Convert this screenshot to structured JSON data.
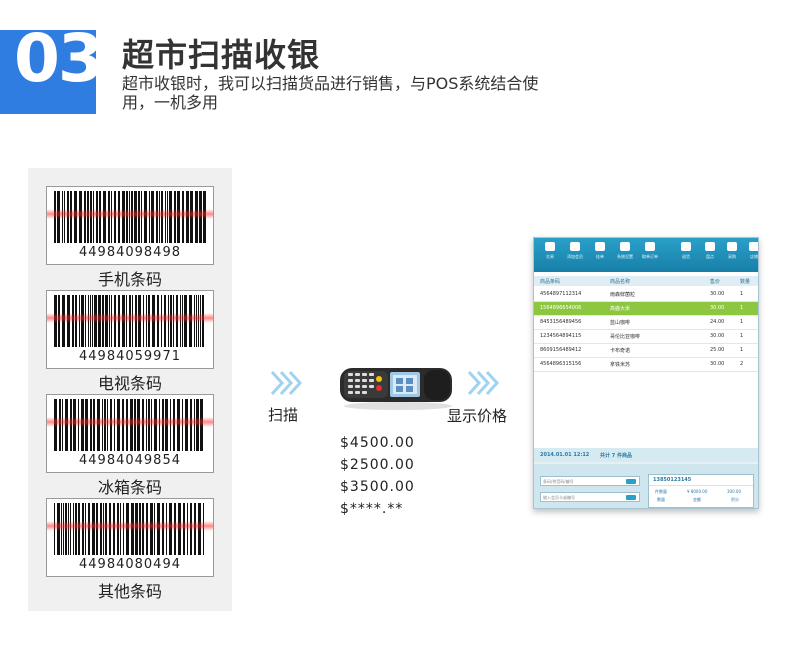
{
  "header": {
    "number": "03",
    "title": "超市扫描收银",
    "subtitle": "超市收银时，我可以扫描货品进行销售，与POS系统结合使用，一机多用"
  },
  "barcodes": [
    {
      "digits": "44984098498",
      "label": "手机条码"
    },
    {
      "digits": "44984059971",
      "label": "电视条码"
    },
    {
      "digits": "44984049854",
      "label": "冰箱条码"
    },
    {
      "digits": "44984080494",
      "label": "其他条码"
    }
  ],
  "flow": {
    "scan_label": "扫描",
    "display_label": "显示价格"
  },
  "prices": [
    "$4500.00",
    "$2500.00",
    "$3500.00",
    "$****.**"
  ],
  "pos": {
    "toolbar": [
      "交易",
      "添加会员",
      "挂单",
      "系统设置",
      "取单订单",
      "退货",
      "盘点",
      "采购",
      "店铺"
    ],
    "columns": [
      "商品条码",
      "商品名称",
      "售价",
      "数量"
    ],
    "rows": [
      {
        "code": "4564897112314",
        "name": "雨森鲜菌粒",
        "price": "30.00",
        "qty": "1",
        "selected": false
      },
      {
        "code": "1564896654006",
        "name": "高盛大米",
        "price": "30.00",
        "qty": "1",
        "selected": true
      },
      {
        "code": "8453156489456",
        "name": "蓝山咖啡",
        "price": "24.00",
        "qty": "1",
        "selected": false
      },
      {
        "code": "1234564894115",
        "name": "哥伦比亚咖啡",
        "price": "30.00",
        "qty": "1",
        "selected": false
      },
      {
        "code": "8609156489412",
        "name": "卡布奇诺",
        "price": "25.00",
        "qty": "1",
        "selected": false
      },
      {
        "code": "4564896315156",
        "name": "拿铁米苏",
        "price": "30.00",
        "qty": "2",
        "selected": false
      }
    ],
    "status_date": "2014.01.01 12:12",
    "status_total": "共计 7 件商品",
    "input1_placeholder": "条码/拼音码/编号",
    "input2_placeholder": "输入会员卡或编号",
    "card_id": "13850123145",
    "card_fields": [
      "件数量",
      "¥ 8000.00",
      "300.00",
      "数量",
      "金额",
      "积分"
    ]
  },
  "colors": {
    "accent_blue": "#2f7de1",
    "pos_toolbar": "#1f8fbb",
    "pos_selected": "#8dc63f",
    "chevron": "#9fd3ee"
  }
}
